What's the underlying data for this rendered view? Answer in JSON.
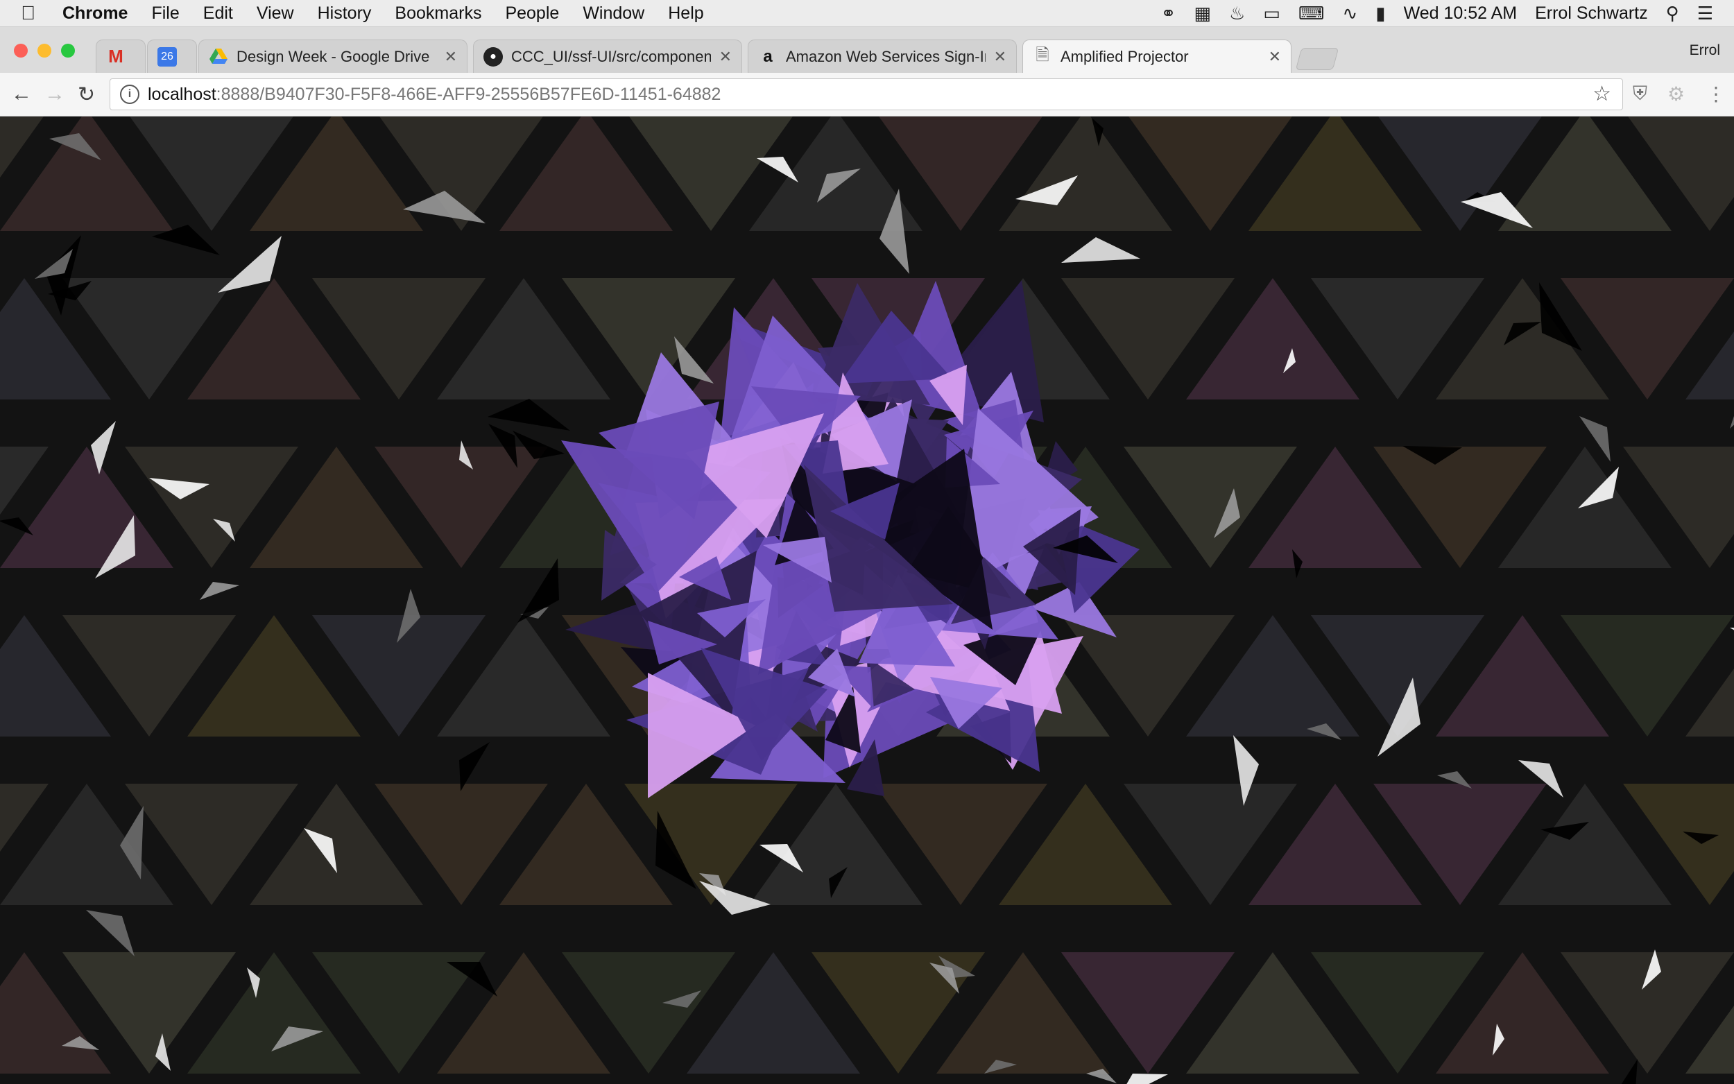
{
  "menubar": {
    "app": "Chrome",
    "items": [
      "File",
      "Edit",
      "View",
      "History",
      "Bookmarks",
      "People",
      "Window",
      "Help"
    ],
    "clock": "Wed 10:52 AM",
    "user": "Errol Schwartz"
  },
  "tabs": [
    {
      "favicon": "gmail-icon",
      "title": "",
      "closable": false
    },
    {
      "favicon": "calendar-icon",
      "title": "",
      "badge": "26",
      "closable": false
    },
    {
      "favicon": "google-drive-icon",
      "title": "Design Week - Google Drive",
      "closable": true
    },
    {
      "favicon": "github-icon",
      "title": "CCC_UI/ssf-UI/src/components",
      "closable": true
    },
    {
      "favicon": "amazon-icon",
      "title": "Amazon Web Services Sign-In",
      "closable": true
    },
    {
      "favicon": "page-icon",
      "title": "Amplified Projector",
      "closable": true,
      "active": true
    }
  ],
  "profile_name": "Errol",
  "address": {
    "host": "localhost",
    "path": ":8888/B9407F30-F5F8-466E-AFF9-25556B57FE6D-11451-64882"
  },
  "colors": {
    "purple_dark": "#3b2a66",
    "purple_mid": "#6a4bb8",
    "purple_light": "#9a78e0",
    "pink_light": "#d8a0f0",
    "background": "#131313"
  }
}
